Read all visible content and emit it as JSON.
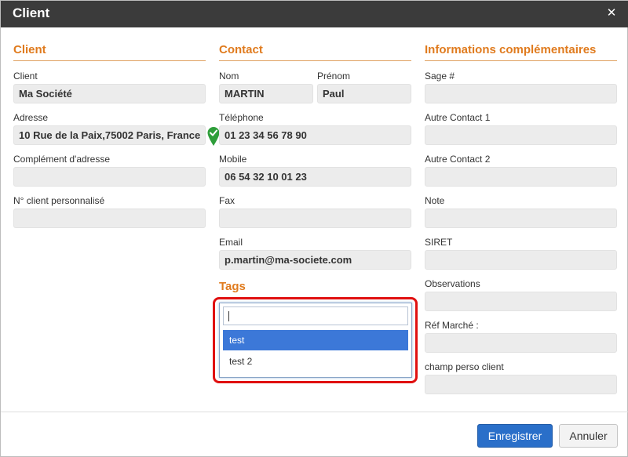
{
  "dialog": {
    "title": "Client"
  },
  "sections": {
    "client": "Client",
    "contact": "Contact",
    "info": "Informations complémentaires",
    "tags": "Tags"
  },
  "client": {
    "client_label": "Client",
    "client_value": "Ma Société",
    "address_label": "Adresse",
    "address_value": "10 Rue de la Paix,75002 Paris, France",
    "address2_label": "Complément d'adresse",
    "address2_value": "",
    "custnum_label": "N° client personnalisé",
    "custnum_value": ""
  },
  "contact": {
    "nom_label": "Nom",
    "nom_value": "MARTIN",
    "prenom_label": "Prénom",
    "prenom_value": "Paul",
    "tel_label": "Téléphone",
    "tel_value": "01 23 34 56 78 90",
    "mobile_label": "Mobile",
    "mobile_value": "06 54 32 10 01 23",
    "fax_label": "Fax",
    "fax_value": "",
    "email_label": "Email",
    "email_value": "p.martin@ma-societe.com"
  },
  "info": {
    "sage_label": "Sage #",
    "sage_value": "",
    "autre1_label": "Autre Contact 1",
    "autre1_value": "",
    "autre2_label": "Autre Contact 2",
    "autre2_value": "",
    "note_label": "Note",
    "note_value": "",
    "siret_label": "SIRET",
    "siret_value": "",
    "obs_label": "Observations",
    "obs_value": "",
    "ref_label": "Réf Marché :",
    "ref_value": "",
    "perso_label": "champ perso client",
    "perso_value": ""
  },
  "tags": {
    "input_value": "",
    "options": [
      "test",
      "test 2"
    ],
    "selected": "test"
  },
  "buttons": {
    "save": "Enregistrer",
    "cancel": "Annuler"
  },
  "icons": {
    "close": "close-icon",
    "map_pin": "map-pin-check-icon"
  },
  "colors": {
    "accent": "#e07b1e",
    "primary": "#2a6fc9",
    "highlight": "#e01010",
    "selected_option": "#3c78d8",
    "pin": "#2e9e3a"
  }
}
